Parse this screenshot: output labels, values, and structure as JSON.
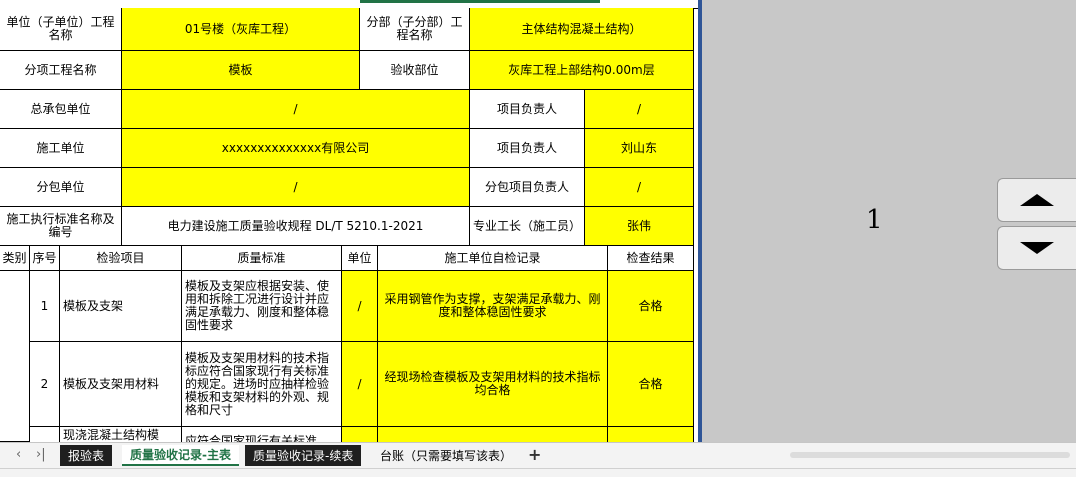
{
  "header": {
    "unit_label": "单位（子单位）工程名称",
    "unit_value": "01号楼（灰库工程）",
    "subdiv_label": "分部（子分部）工程名称",
    "subdiv_value": "主体结构混凝土结构）",
    "item_label": "分项工程名称",
    "item_value": "模板",
    "accept_label": "验收部位",
    "accept_value": "灰库工程上部结构0.00m层",
    "gc_label": "总承包单位",
    "gc_value": "/",
    "pm_label": "项目负责人",
    "pm_value": "/",
    "builder_label": "施工单位",
    "builder_value": "xxxxxxxxxxxxxx有限公司",
    "pm2_label": "项目负责人",
    "pm2_value": "刘山东",
    "sub_label": "分包单位",
    "sub_value": "/",
    "subpm_label": "分包项目负责人",
    "subpm_value": "/",
    "std_label": "施工执行标准名称及编号",
    "std_value": "电力建设施工质量验收规程 DL/T 5210.1-2021",
    "foreman_label": "专业工长（施工员）",
    "foreman_value": "张伟"
  },
  "columns": [
    "类别",
    "序号",
    "检验项目",
    "质量标准",
    "单位",
    "施工单位自检记录",
    "检查结果"
  ],
  "rows": [
    {
      "seq": "1",
      "item": "模板及支架",
      "standard": "模板及支架应根据安装、使用和拆除工况进行设计并应满足承载力、刚度和整体稳固性要求",
      "unit": "/",
      "record": "采用钢管作为支撑，支架满足承载力、刚度和整体稳固性要求",
      "result": "合格"
    },
    {
      "seq": "2",
      "item": "模板及支架用材料",
      "standard": "模板及支架用材料的技术指标应符合国家现行有关标准的规定。进场时应抽样检验模板和支架材料的外观、规格和尺寸",
      "unit": "/",
      "record": "经现场检查模板及支架用材料的技术指标均合格",
      "result": "合格"
    },
    {
      "seq": "",
      "item": "现浇混凝土结构模",
      "standard": "应符合国家现行有关标准",
      "unit": "",
      "record": "",
      "result": ""
    }
  ],
  "preview": {
    "page_number": "1"
  },
  "tabs": {
    "nav_prev": "‹",
    "nav_last": "›|",
    "sheet1": "报验表",
    "sheet2": "质量验收记录-主表",
    "sheet3": "质量验收记录-续表",
    "sheet4": "台账（只需要填写该表）",
    "add": "+"
  },
  "colors": {
    "highlight": "#ffff00",
    "active_tab": "#217346",
    "divider": "#2f5597",
    "panel": "#c8c8c8"
  }
}
